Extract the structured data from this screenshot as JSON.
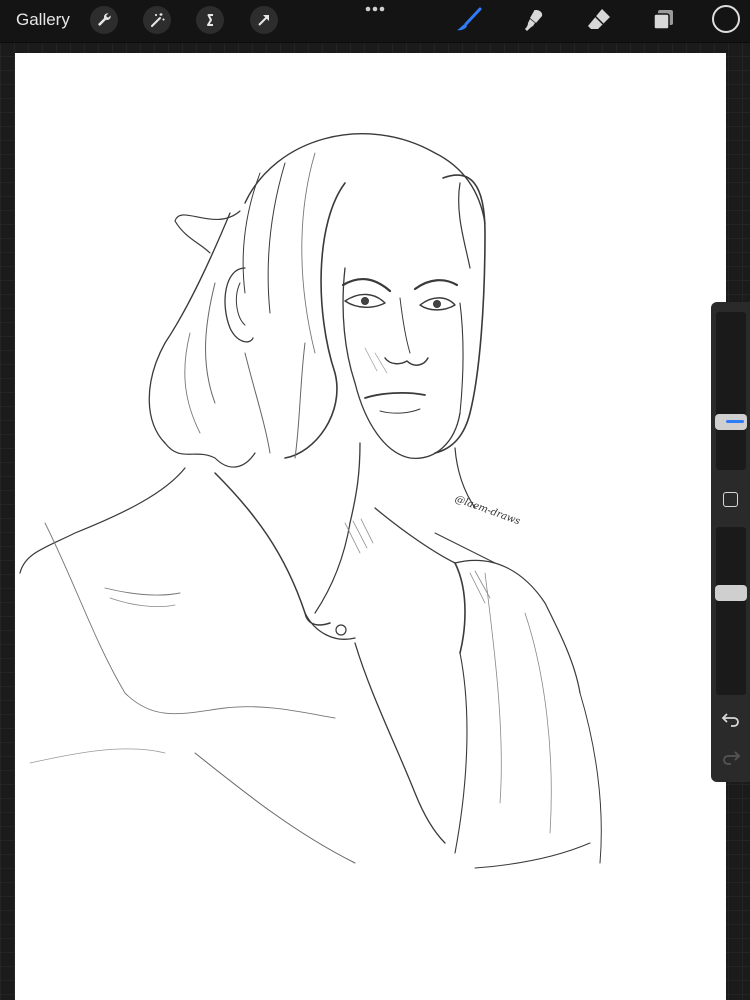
{
  "topbar": {
    "gallery_label": "Gallery",
    "left_tools": [
      "wrench-icon",
      "magic-wand-icon",
      "selection-s-icon",
      "transform-arrow-icon"
    ],
    "right_tools": [
      "brush-icon",
      "smudge-icon",
      "eraser-icon",
      "layers-icon"
    ],
    "active_tool": "brush-icon",
    "accent_color": "#2e7cf6",
    "current_color": "#141414"
  },
  "canvas": {
    "signature": "@laem-draws",
    "background": "#ffffff"
  },
  "sidebar": {
    "brush_size_level": 0.28,
    "opacity_level": 0.62,
    "icons": [
      "modify-square-icon",
      "undo-icon",
      "redo-icon"
    ]
  }
}
